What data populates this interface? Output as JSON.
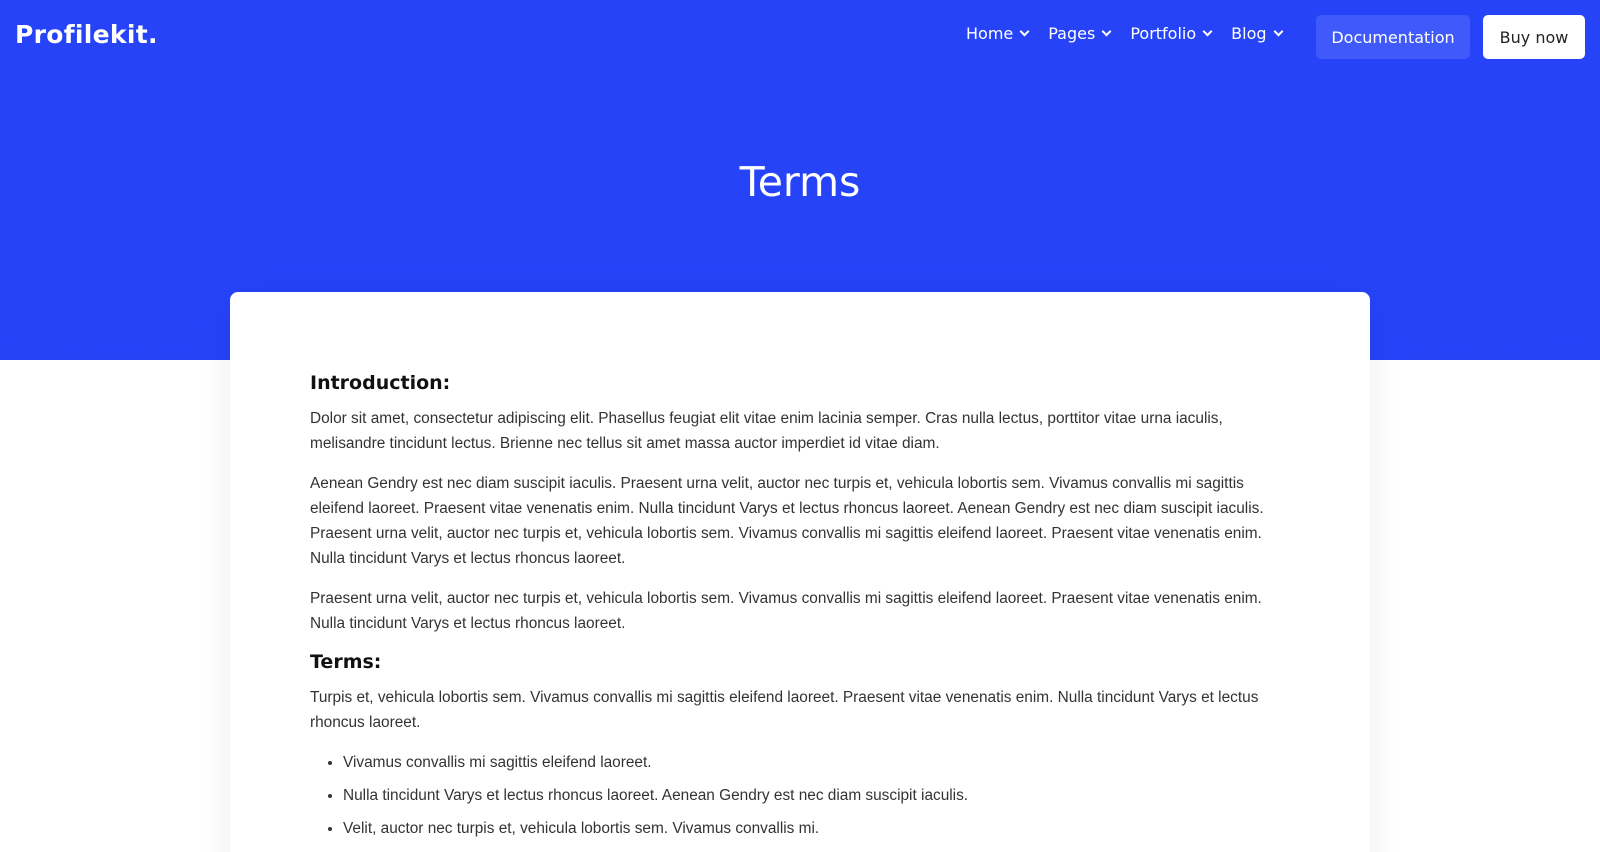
{
  "brand": {
    "logo": "Profilekit."
  },
  "nav": {
    "items": [
      {
        "label": "Home"
      },
      {
        "label": "Pages"
      },
      {
        "label": "Portfolio"
      },
      {
        "label": "Blog"
      }
    ],
    "docs_label": "Documentation",
    "buy_label": "Buy now"
  },
  "hero": {
    "title": "Terms"
  },
  "content": {
    "intro_heading": "Introduction:",
    "intro_paragraphs": [
      "Dolor sit amet, consectetur adipiscing elit. Phasellus feugiat elit vitae enim lacinia semper. Cras nulla lectus, porttitor vitae urna iaculis, melisandre tincidunt lectus. Brienne nec tellus sit amet massa auctor imperdiet id vitae diam.",
      "Aenean Gendry est nec diam suscipit iaculis. Praesent urna velit, auctor nec turpis et, vehicula lobortis sem. Vivamus convallis mi sagittis eleifend laoreet. Praesent vitae venenatis enim. Nulla tincidunt Varys et lectus rhoncus laoreet. Aenean Gendry est nec diam suscipit iaculis. Praesent urna velit, auctor nec turpis et, vehicula lobortis sem. Vivamus convallis mi sagittis eleifend laoreet. Praesent vitae venenatis enim. Nulla tincidunt Varys et lectus rhoncus laoreet.",
      "Praesent urna velit, auctor nec turpis et, vehicula lobortis sem. Vivamus convallis mi sagittis eleifend laoreet. Praesent vitae venenatis enim. Nulla tincidunt Varys et lectus rhoncus laoreet."
    ],
    "terms_heading": "Terms:",
    "terms_paragraph": "Turpis et, vehicula lobortis sem. Vivamus convallis mi sagittis eleifend laoreet. Praesent vitae venenatis enim. Nulla tincidunt Varys et lectus rhoncus laoreet.",
    "terms_list": [
      "Vivamus convallis mi sagittis eleifend laoreet.",
      "Nulla tincidunt Varys et lectus rhoncus laoreet. Aenean Gendry est nec diam suscipit iaculis.",
      "Velit, auctor nec turpis et, vehicula lobortis sem. Vivamus convallis mi."
    ]
  },
  "colors": {
    "primary": "#2643f8",
    "docs_button": "#3f59fa",
    "white": "#ffffff",
    "text": "#333333"
  },
  "icons": {
    "nav_dropdown": "chevron-down-icon"
  }
}
